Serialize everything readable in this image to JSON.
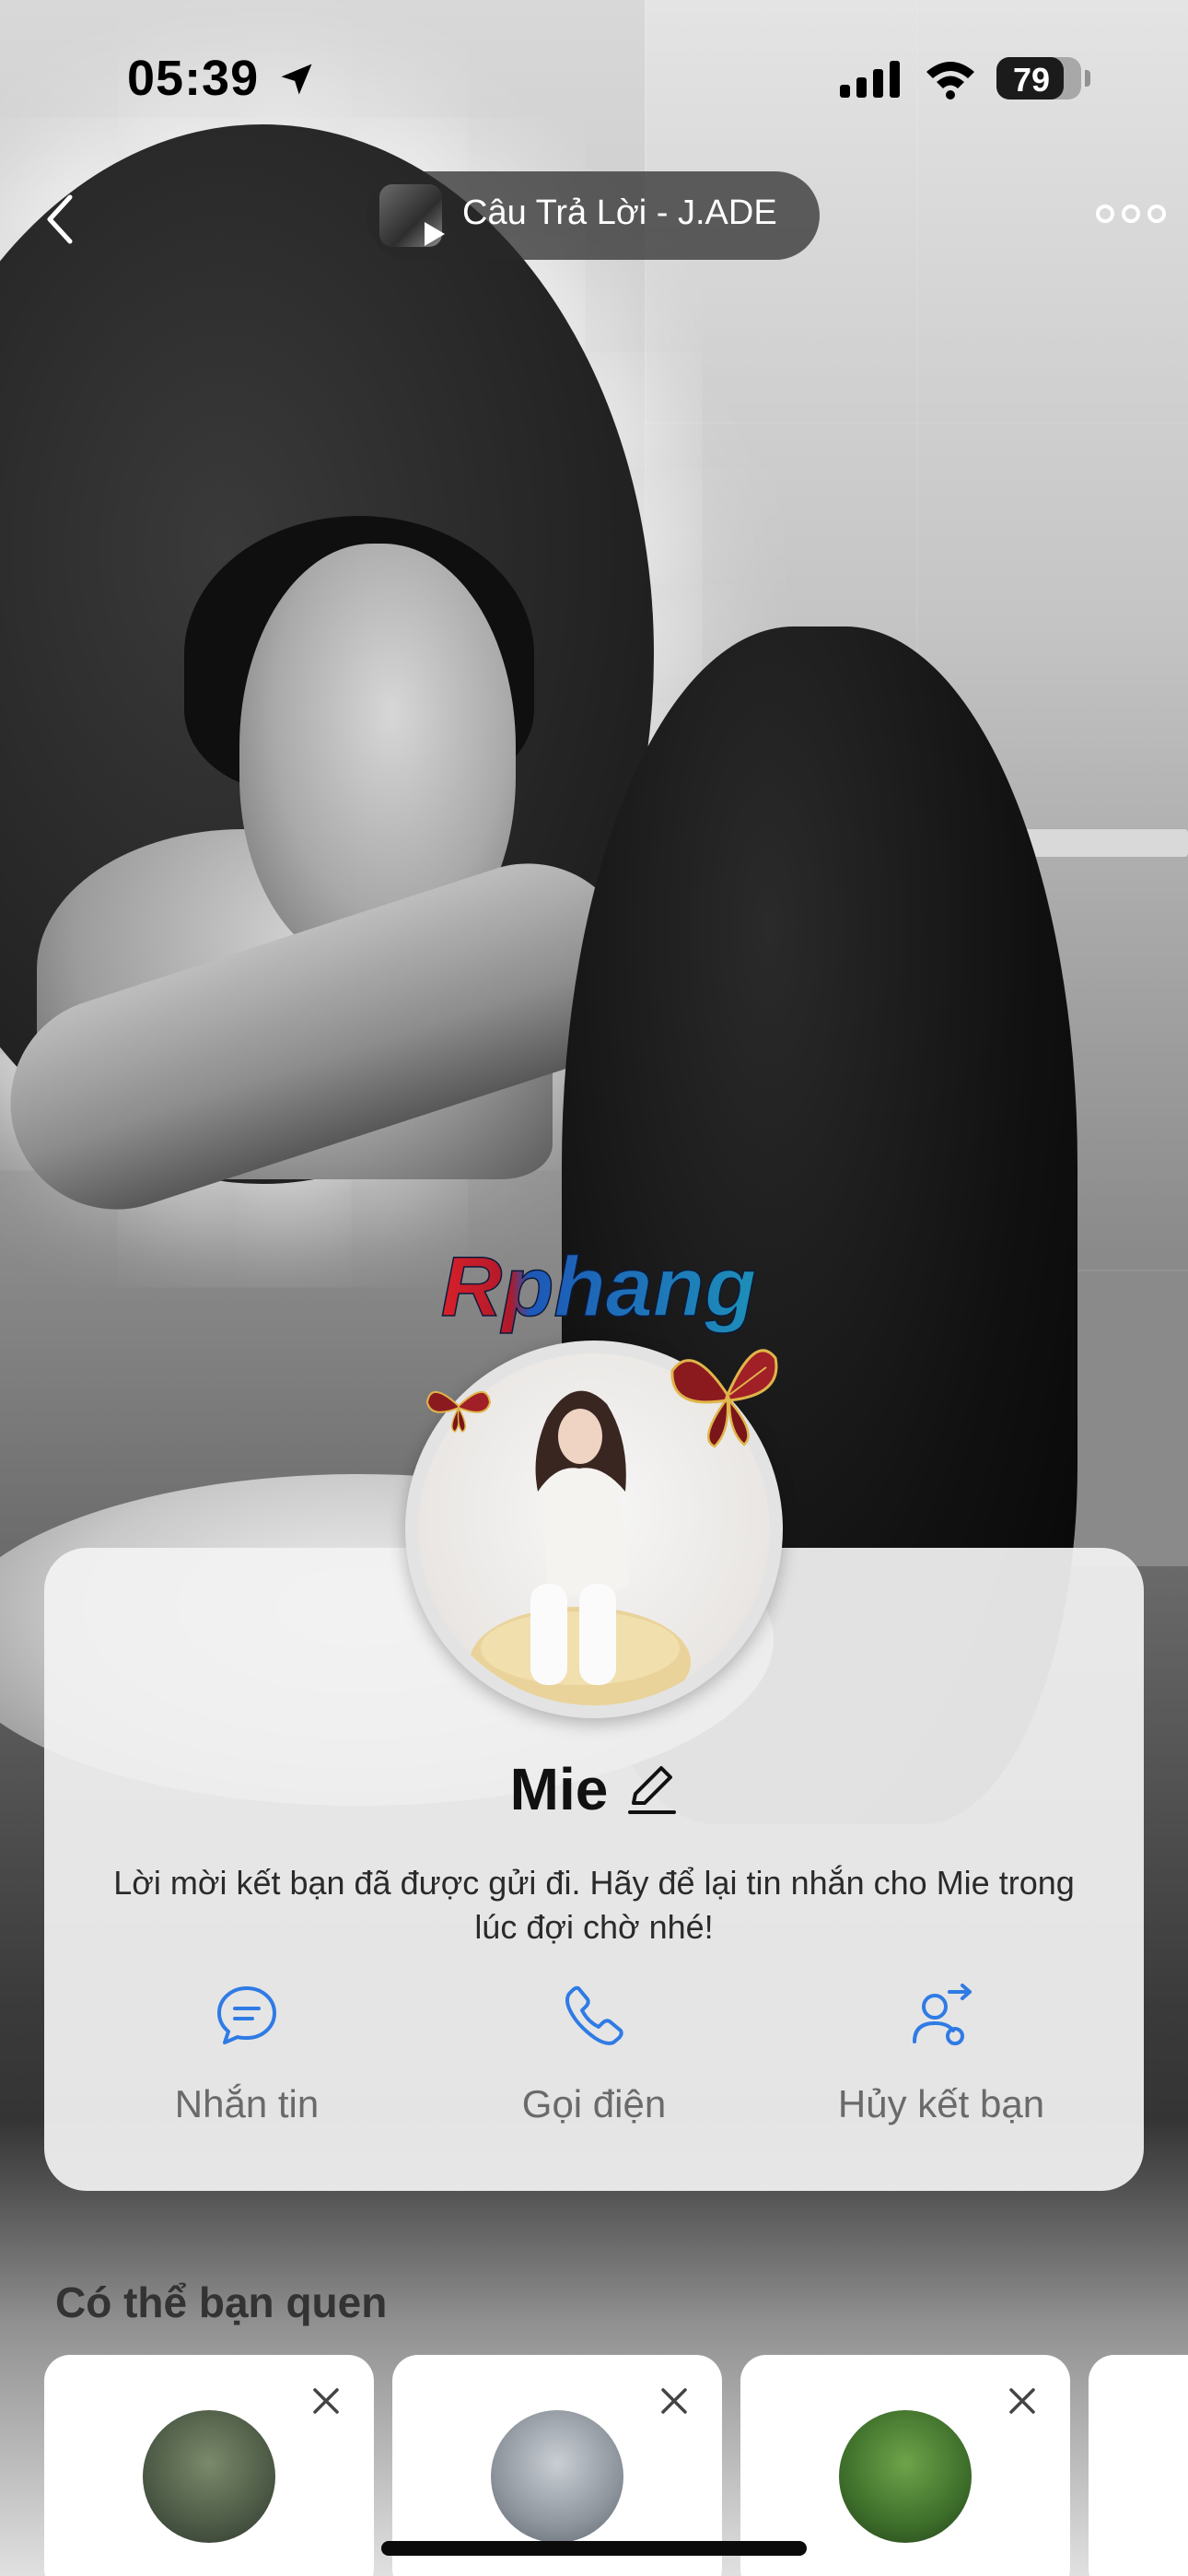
{
  "status_bar": {
    "time": "05:39",
    "battery_level": "79",
    "battery_fraction": 0.79
  },
  "top_nav": {
    "music_title": "Câu Trả Lời - J.ADE"
  },
  "watermark": {
    "text": "Rphang"
  },
  "profile": {
    "name": "Mie",
    "friend_request_message": "Lời mời kết bạn đã được gửi đi. Hãy để lại tin nhắn cho Mie trong lúc đợi chờ nhé!"
  },
  "actions": [
    {
      "label": "Nhắn tin",
      "icon": "chat-bubble-icon"
    },
    {
      "label": "Gọi điện",
      "icon": "phone-icon"
    },
    {
      "label": "Hủy kết bạn",
      "icon": "unfriend-icon"
    }
  ],
  "suggestions": {
    "title": "Có thể bạn quen"
  },
  "colors": {
    "accent": "#2F7BE5",
    "card_background": "#F2F2F2",
    "action_label": "#6A6A6A"
  }
}
